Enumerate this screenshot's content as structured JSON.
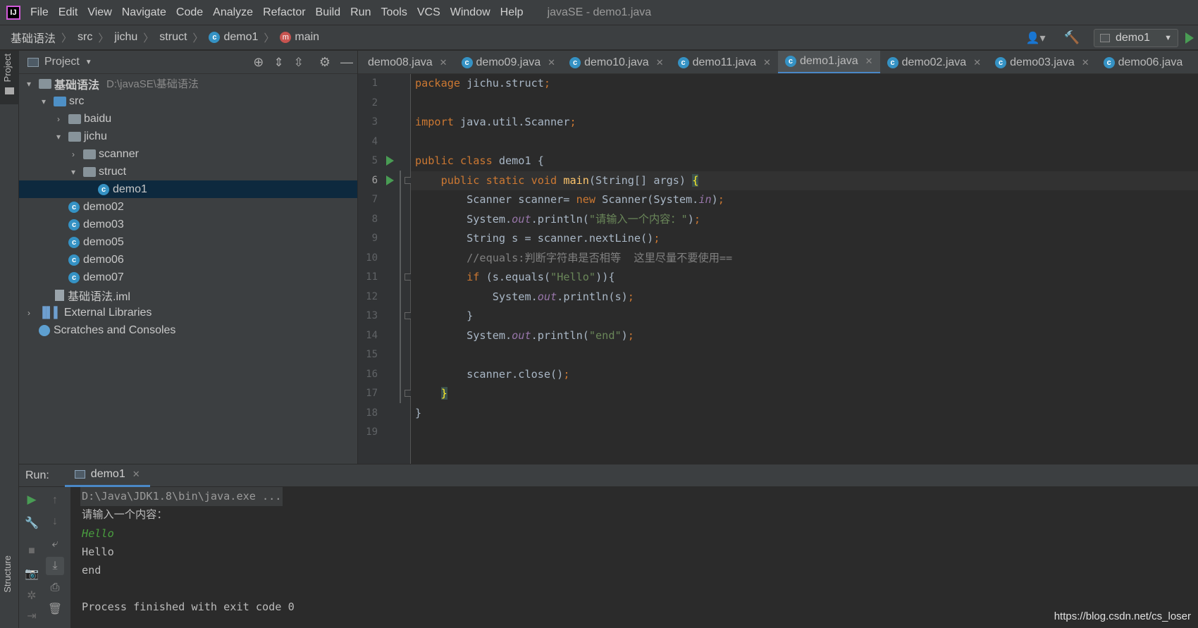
{
  "app": {
    "logo_text": "IJ",
    "window_title": "javaSE - demo1.java"
  },
  "menu": [
    "File",
    "Edit",
    "View",
    "Navigate",
    "Code",
    "Analyze",
    "Refactor",
    "Build",
    "Run",
    "Tools",
    "VCS",
    "Window",
    "Help"
  ],
  "breadcrumb": [
    "基础语法",
    "src",
    "jichu",
    "struct",
    "demo1",
    "main"
  ],
  "run_config": {
    "label": "demo1"
  },
  "side_tabs": {
    "project": "Project",
    "structure": "Structure"
  },
  "project_panel": {
    "title": "Project",
    "tree": [
      {
        "label": "基础语法",
        "path": "D:\\javaSE\\基础语法"
      },
      {
        "label": "src"
      },
      {
        "label": "baidu"
      },
      {
        "label": "jichu"
      },
      {
        "label": "scanner"
      },
      {
        "label": "struct"
      },
      {
        "label": "demo1"
      },
      {
        "label": "demo02"
      },
      {
        "label": "demo03"
      },
      {
        "label": "demo05"
      },
      {
        "label": "demo06"
      },
      {
        "label": "demo07"
      },
      {
        "label": "基础语法.iml"
      },
      {
        "label": "External Libraries"
      },
      {
        "label": "Scratches and Consoles"
      }
    ]
  },
  "editor_tabs": [
    "demo08.java",
    "demo09.java",
    "demo10.java",
    "demo11.java",
    "demo1.java",
    "demo02.java",
    "demo03.java",
    "demo06.java"
  ],
  "line_numbers": [
    "1",
    "2",
    "3",
    "4",
    "5",
    "6",
    "7",
    "8",
    "9",
    "10",
    "11",
    "12",
    "13",
    "14",
    "15",
    "16",
    "17",
    "18",
    "19"
  ],
  "code": {
    "l1_kw": "package",
    "l1_rest": " jichu.struct",
    "l1_semi": ";",
    "l3_kw": "import",
    "l3_rest": " java.util.Scanner",
    "l3_semi": ";",
    "l5_kw": "public class",
    "l5_rest": " demo1 {",
    "l6_indent": "    ",
    "l6_kw": "public static void",
    "l6_sp": " ",
    "l6_fn": "main",
    "l6_rest": "(String[] args) ",
    "l6_brace": "{",
    "l7_a": "        Scanner scanner= ",
    "l7_kw": "new",
    "l7_b": " Scanner(System.",
    "l7_st": "in",
    "l7_c": ")",
    "l7_semi": ";",
    "l8_a": "        System.",
    "l8_st": "out",
    "l8_b": ".println(",
    "l8_str": "\"请输入一个内容：\"",
    "l8_c": ")",
    "l8_semi": ";",
    "l9_a": "        String s = scanner.nextLine()",
    "l9_semi": ";",
    "l10_cm": "        //equals:判断字符串是否相等  这里尽量不要使用==",
    "l11_a": "        ",
    "l11_kw": "if",
    "l11_b": " (s.equals(",
    "l11_str": "\"Hello\"",
    "l11_c": ")){",
    "l12_a": "            System.",
    "l12_st": "out",
    "l12_b": ".println(s)",
    "l12_semi": ";",
    "l13": "        }",
    "l14_a": "        System.",
    "l14_st": "out",
    "l14_b": ".println(",
    "l14_str": "\"end\"",
    "l14_c": ")",
    "l14_semi": ";",
    "l16_a": "        scanner.close()",
    "l16_semi": ";",
    "l17_indent": "    ",
    "l17_brace": "}",
    "l18": "}"
  },
  "run_panel": {
    "label": "Run:",
    "tab": "demo1"
  },
  "console": {
    "cmd": "D:\\Java\\JDK1.8\\bin\\java.exe ...",
    "prompt": "请输入一个内容：",
    "user_input": "Hello",
    "out1": "Hello",
    "out2": "end",
    "finished": "Process finished with exit code 0"
  },
  "watermark": "https://blog.csdn.net/cs_loser",
  "colors": {
    "keyword": "#cc7832",
    "string": "#6a8759",
    "static_field": "#9876aa",
    "method": "#ffc66d",
    "comment": "#808080",
    "run_green": "#499c54",
    "selection": "#0d293e"
  }
}
